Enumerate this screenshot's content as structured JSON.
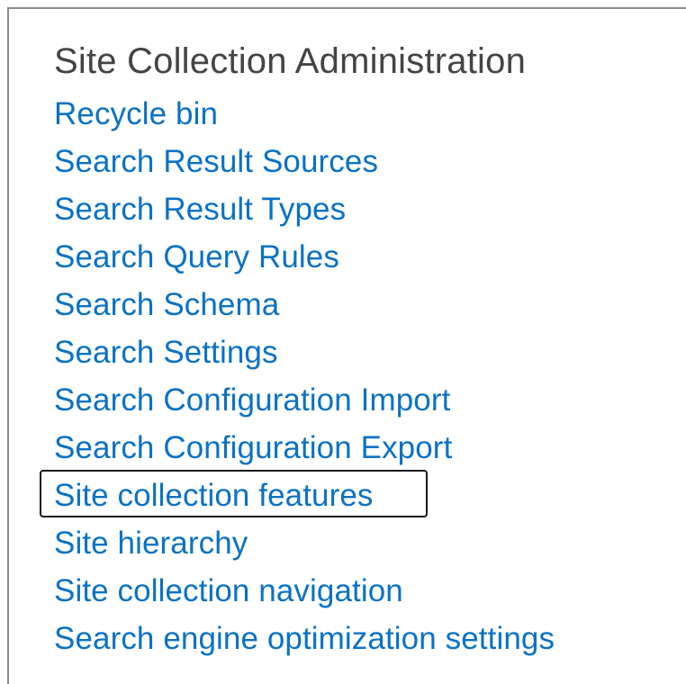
{
  "section": {
    "title": "Site Collection Administration",
    "links": [
      {
        "label": "Recycle bin"
      },
      {
        "label": "Search Result Sources"
      },
      {
        "label": "Search Result Types"
      },
      {
        "label": "Search Query Rules"
      },
      {
        "label": "Search Schema"
      },
      {
        "label": "Search Settings"
      },
      {
        "label": "Search Configuration Import"
      },
      {
        "label": "Search Configuration Export"
      },
      {
        "label": "Site collection features",
        "highlighted": true
      },
      {
        "label": "Site hierarchy"
      },
      {
        "label": "Site collection navigation"
      },
      {
        "label": "Search engine optimization settings"
      }
    ]
  },
  "colors": {
    "link": "#0b72c4",
    "heading": "#444444",
    "highlight_border": "#1a1a1a",
    "panel_border": "#8a8a8a"
  }
}
